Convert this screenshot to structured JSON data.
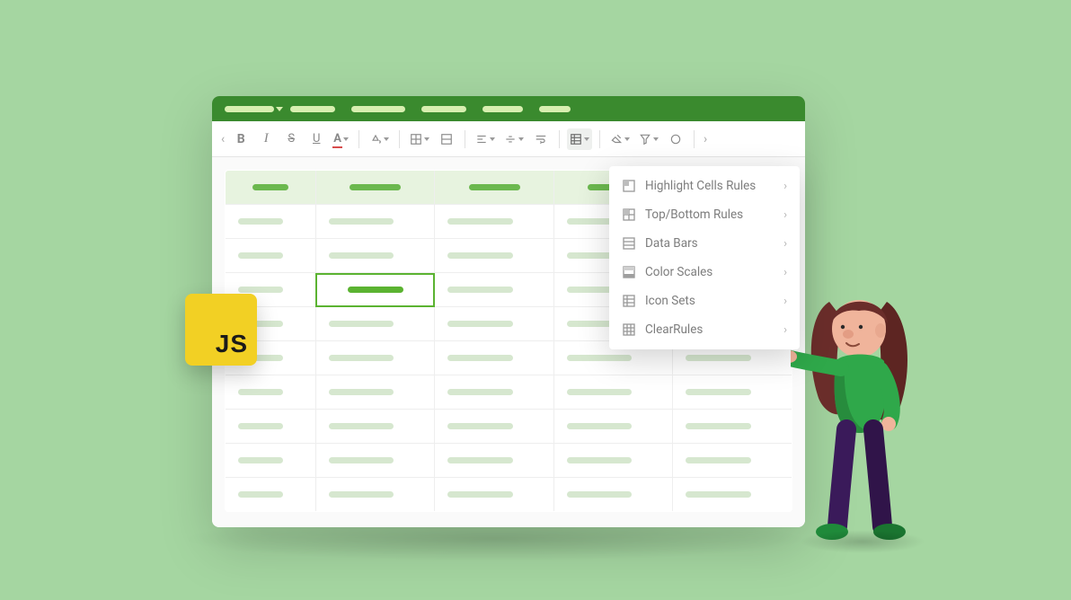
{
  "badge": {
    "label": "JS"
  },
  "toolbar": {
    "bold": "B",
    "italic": "I",
    "strike": "S",
    "underline": "U",
    "font_color": "A"
  },
  "dropdown": {
    "items": [
      {
        "label": "Highlight Cells Rules"
      },
      {
        "label": "Top/Bottom Rules"
      },
      {
        "label": "Data Bars"
      },
      {
        "label": "Color Scales"
      },
      {
        "label": "Icon Sets"
      },
      {
        "label": "ClearRules"
      }
    ]
  },
  "colors": {
    "accent_green": "#5bb331",
    "header_green": "#3a8a2e",
    "badge_yellow": "#f2d024"
  }
}
